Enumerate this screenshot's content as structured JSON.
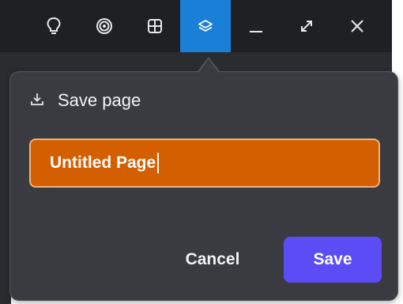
{
  "titlebar": {
    "buttons": [
      {
        "icon": "lightbulb-icon"
      },
      {
        "icon": "target-icon"
      },
      {
        "icon": "grid-icon"
      },
      {
        "icon": "layers-icon",
        "active": true
      },
      {
        "icon": "minimize-icon"
      },
      {
        "icon": "maximize-icon"
      },
      {
        "icon": "close-icon"
      }
    ]
  },
  "dialog": {
    "title": "Save page",
    "title_icon": "download-icon",
    "input_value": "Untitled Page",
    "cancel_label": "Cancel",
    "save_label": "Save"
  },
  "colors": {
    "titlebar_bg": "#1f2023",
    "active_tab": "#1a7fd6",
    "popup_bg": "#393b41",
    "input_bg": "#d35f00",
    "input_border": "#f0b27a",
    "primary_button": "#5b4cf5"
  }
}
